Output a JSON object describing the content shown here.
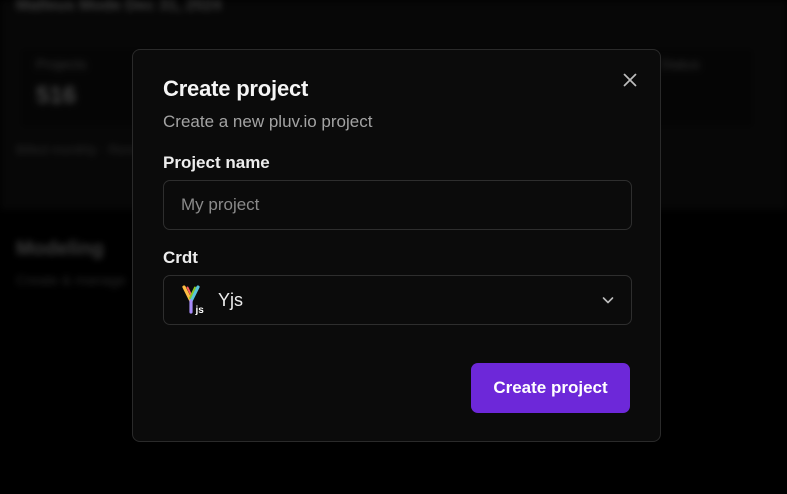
{
  "background": {
    "page_title": "Malleus Mode Dec 31, 2024",
    "stat_label": "Projects",
    "stat_value": "516",
    "stat_label_2": "Status",
    "note": "Billed monthly · Renews soon",
    "section_title": "Modeling",
    "section_subtitle": "Create & manage"
  },
  "modal": {
    "title": "Create project",
    "subtitle": "Create a new pluv.io project",
    "close_icon": "close-icon",
    "fields": {
      "project_name": {
        "label": "Project name",
        "placeholder": "My project",
        "value": ""
      },
      "crdt": {
        "label": "Crdt",
        "selected": "Yjs",
        "icon": "yjs-logo-icon"
      }
    },
    "submit_label": "Create project"
  },
  "colors": {
    "accent": "#6d28d9",
    "modal_bg": "#0b0b0b",
    "border": "#2e2e2e"
  }
}
